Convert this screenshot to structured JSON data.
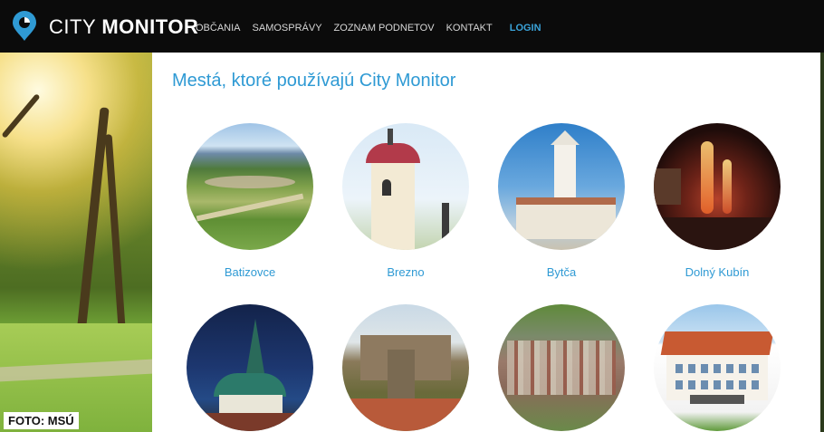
{
  "brand": {
    "name_light": "CITY",
    "name_bold": "MONITOR"
  },
  "nav": [
    {
      "label": "OBČANIA"
    },
    {
      "label": "SAMOSPRÁVY"
    },
    {
      "label": "ZOZNAM PODNETOV"
    },
    {
      "label": "KONTAKT"
    },
    {
      "label": "LOGIN"
    }
  ],
  "main": {
    "title": "Mestá, ktoré používajú City Monitor",
    "cities": [
      {
        "name": "Batizovce"
      },
      {
        "name": "Brezno"
      },
      {
        "name": "Bytča"
      },
      {
        "name": "Dolný Kubín"
      },
      {
        "name": ""
      },
      {
        "name": ""
      },
      {
        "name": ""
      },
      {
        "name": ""
      }
    ]
  },
  "photo_credit": "FOTO: MSÚ",
  "colors": {
    "accent": "#2f9ad4",
    "topbar": "#0b0b0b",
    "login": "#3aa3d9"
  }
}
